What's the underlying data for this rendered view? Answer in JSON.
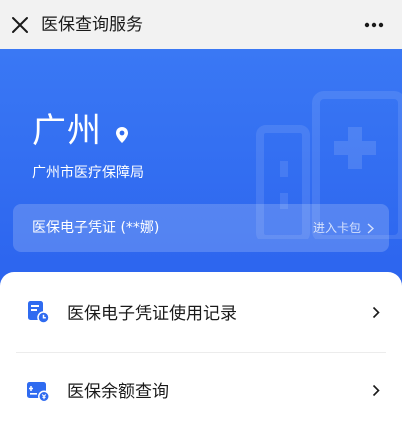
{
  "nav": {
    "title": "医保查询服务",
    "close_icon": "close-icon",
    "more_icon": "more-icon"
  },
  "hero": {
    "city": "广州",
    "bureau": "广州市医疗保障局",
    "card": {
      "label": "医保电子凭证 (**娜)",
      "action": "进入卡包"
    }
  },
  "menu": {
    "items": [
      {
        "label": "医保电子凭证使用记录",
        "icon": "record-icon"
      },
      {
        "label": "医保余额查询",
        "icon": "balance-icon"
      }
    ]
  },
  "colors": {
    "brand_blue": "#2f6bf0",
    "icon_blue": "#2f6bf0",
    "white": "#ffffff"
  }
}
